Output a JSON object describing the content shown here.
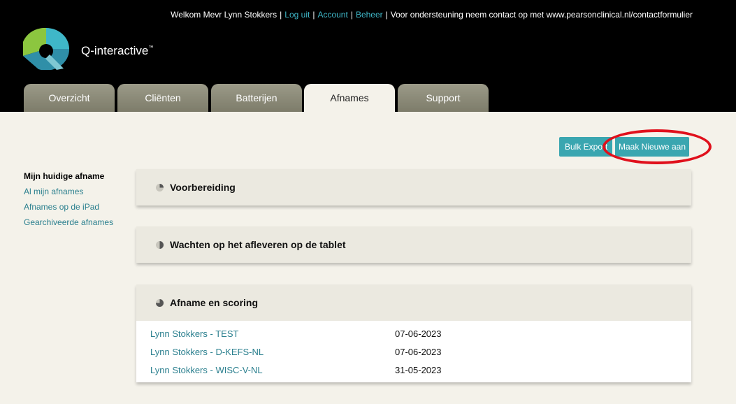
{
  "topbar": {
    "welcome": "Welkom Mevr Lynn Stokkers",
    "logout": "Log uit",
    "account": "Account",
    "admin": "Beheer",
    "support_note": "Voor ondersteuning neem contact op met www.pearsonclinical.nl/contactformulier"
  },
  "brand": {
    "name": "Q-interactive",
    "tm": "™"
  },
  "tabs": [
    {
      "label": "Overzicht"
    },
    {
      "label": "Cliënten"
    },
    {
      "label": "Batterijen"
    },
    {
      "label": "Afnames"
    },
    {
      "label": "Support"
    }
  ],
  "active_tab": "Afnames",
  "actions": {
    "bulk_export": "Bulk Export",
    "new": "Maak Nieuwe aan"
  },
  "sidebar": {
    "items": [
      {
        "label": "Mijn huidige afname"
      },
      {
        "label": "Al mijn afnames"
      },
      {
        "label": "Afnames op de iPad"
      },
      {
        "label": "Gearchiveerde afnames"
      }
    ]
  },
  "sections": [
    {
      "title": "Voorbereiding"
    },
    {
      "title": "Wachten op het afleveren op de tablet"
    },
    {
      "title": "Afname en scoring",
      "rows": [
        {
          "name": "Lynn Stokkers - TEST",
          "date": "07-06-2023"
        },
        {
          "name": "Lynn Stokkers - D-KEFS-NL",
          "date": "07-06-2023"
        },
        {
          "name": "Lynn Stokkers - WISC-V-NL",
          "date": "31-05-2023"
        }
      ]
    }
  ],
  "colors": {
    "accent": "#3aa6b0",
    "link": "#2a7f8e",
    "annotation": "#e0101c",
    "header": "#000000",
    "content_bg": "#f4f2ea"
  }
}
